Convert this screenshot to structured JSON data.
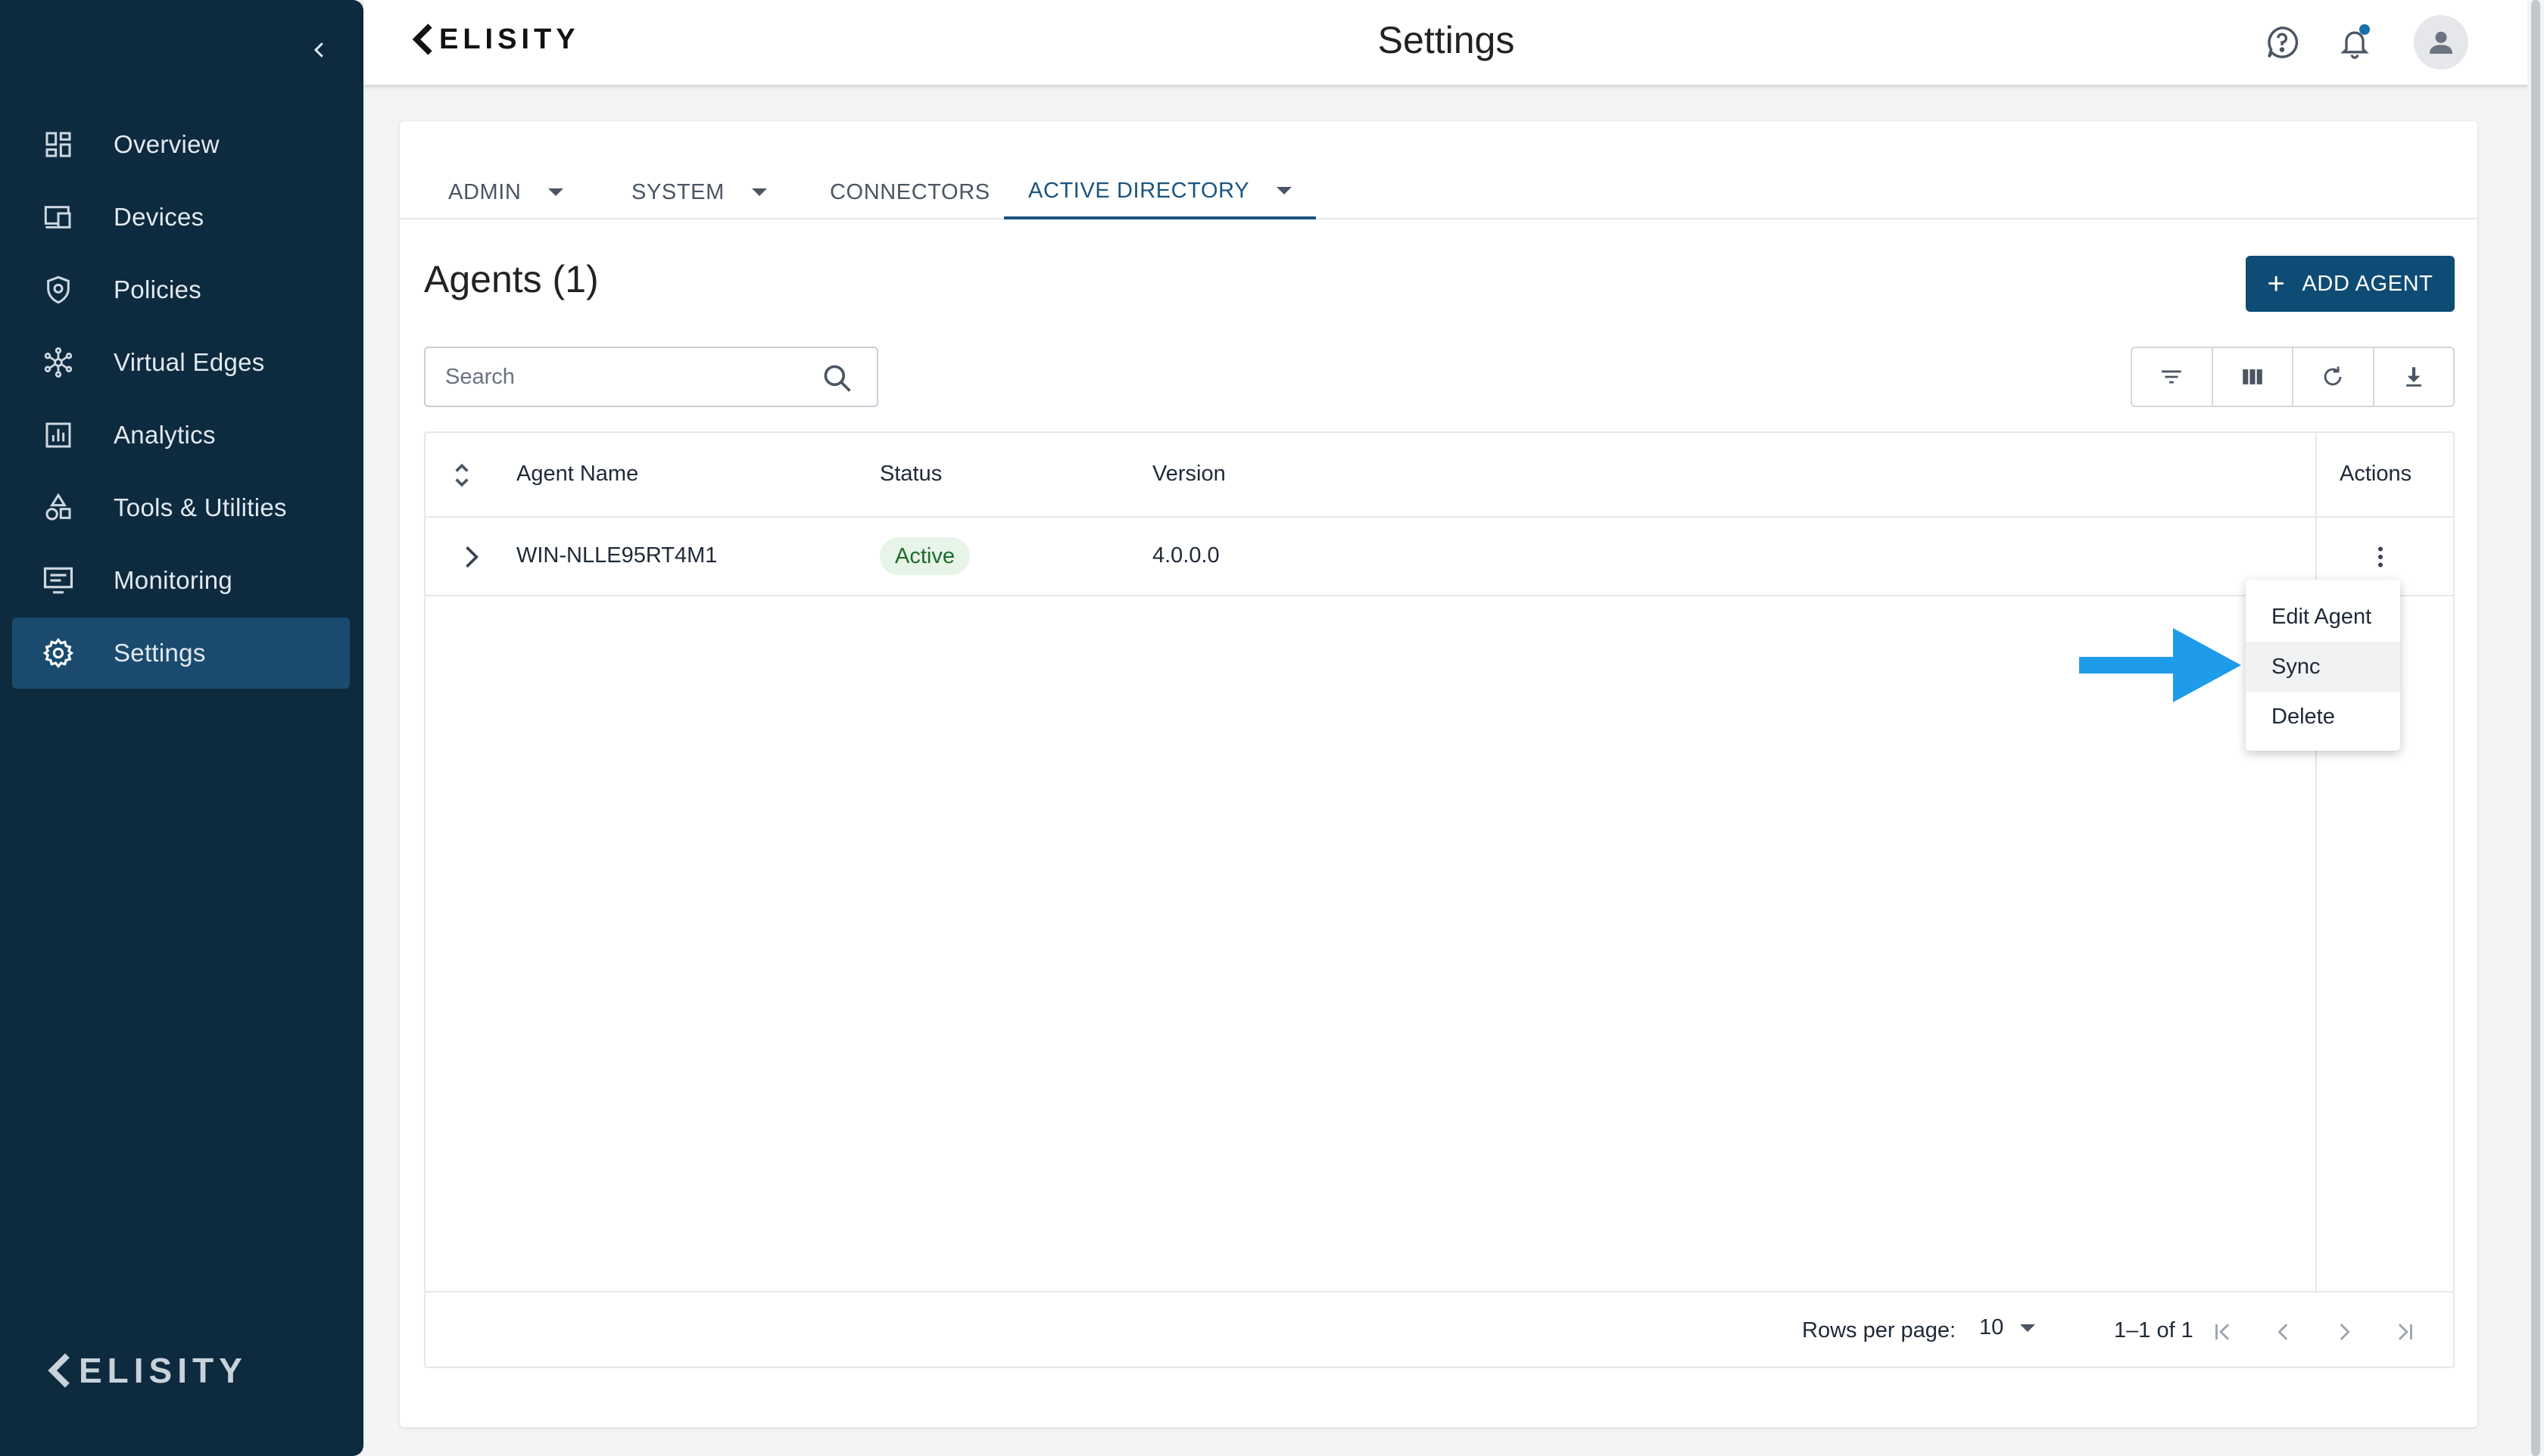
{
  "brand": {
    "name": "ELISITY"
  },
  "header": {
    "title": "Settings"
  },
  "sidebar": {
    "items": [
      {
        "label": "Overview",
        "icon": "dashboard-icon",
        "active": false
      },
      {
        "label": "Devices",
        "icon": "devices-icon",
        "active": false
      },
      {
        "label": "Policies",
        "icon": "shield-icon",
        "active": false
      },
      {
        "label": "Virtual Edges",
        "icon": "network-hub-icon",
        "active": false
      },
      {
        "label": "Analytics",
        "icon": "analytics-chart-icon",
        "active": false
      },
      {
        "label": "Tools & Utilities",
        "icon": "tools-shapes-icon",
        "active": false
      },
      {
        "label": "Monitoring",
        "icon": "monitor-icon",
        "active": false
      },
      {
        "label": "Settings",
        "icon": "gear-icon",
        "active": true
      }
    ]
  },
  "tabs": [
    {
      "label": "ADMIN",
      "has_dropdown": true,
      "active": false
    },
    {
      "label": "SYSTEM",
      "has_dropdown": true,
      "active": false
    },
    {
      "label": "CONNECTORS",
      "has_dropdown": false,
      "active": false
    },
    {
      "label": "ACTIVE DIRECTORY",
      "has_dropdown": true,
      "active": true
    }
  ],
  "section": {
    "title": "Agents (1)",
    "add_button": "ADD AGENT"
  },
  "search": {
    "placeholder": "Search",
    "value": ""
  },
  "table": {
    "columns": [
      "Agent Name",
      "Status",
      "Version",
      "Actions"
    ],
    "rows": [
      {
        "agent_name": "WIN-NLLE95RT4M1",
        "status": "Active",
        "version": "4.0.0.0"
      }
    ]
  },
  "row_menu": {
    "items": [
      "Edit Agent",
      "Sync",
      "Delete"
    ],
    "highlighted": "Sync"
  },
  "pagination": {
    "rows_per_page_label": "Rows per page:",
    "rows_per_page": "10",
    "range": "1–1 of 1"
  },
  "colors": {
    "sidebar_bg": "#0d2a3f",
    "sidebar_active": "#1a4b6e",
    "accent": "#0f4c75",
    "active_tab": "#1a5480",
    "status_active_bg": "#e7f4e8",
    "status_active_fg": "#1e6b2c",
    "annotation_arrow": "#1e9be9"
  }
}
